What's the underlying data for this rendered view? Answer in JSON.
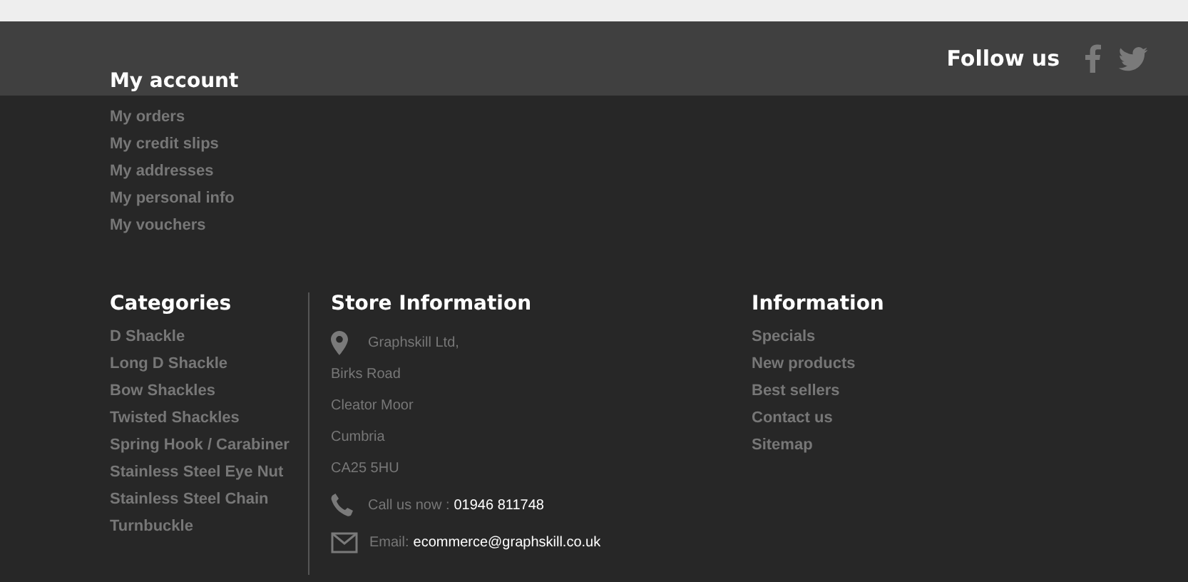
{
  "follow_us": {
    "label": "Follow us"
  },
  "my_account": {
    "title": "My account",
    "links": [
      "My orders",
      "My credit slips",
      "My addresses",
      "My personal info",
      "My vouchers"
    ]
  },
  "categories": {
    "title": "Categories",
    "links": [
      "D Shackle",
      "Long D Shackle",
      "Bow Shackles",
      "Twisted Shackles",
      "Spring Hook / Carabiner",
      "Stainless Steel Eye Nut",
      "Stainless Steel Chain",
      "Turnbuckle"
    ]
  },
  "store_information": {
    "title": "Store Information",
    "address": [
      "Graphskill Ltd,",
      "Birks Road",
      "Cleator Moor",
      "Cumbria",
      "CA25 5HU"
    ],
    "phone": {
      "label": "Call us now :",
      "value": "01946 811748"
    },
    "email": {
      "label": "Email:",
      "value": "ecommerce@graphskill.co.uk"
    }
  },
  "information": {
    "title": "Information",
    "links": [
      "Specials",
      "New products",
      "Best sellers",
      "Contact us",
      "Sitemap"
    ]
  }
}
